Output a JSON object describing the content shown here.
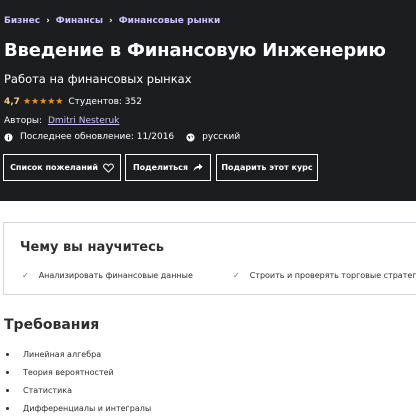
{
  "breadcrumb": [
    {
      "label": "Бизнес"
    },
    {
      "label": "Финансы"
    },
    {
      "label": "Финансовые рынки"
    }
  ],
  "course": {
    "title": "Введение в Финансовую Инженерию",
    "subtitle": "Работа на финансовых рынках",
    "rating": "4,7",
    "rating_stars": 4.5,
    "students": "Студентов: 352",
    "authors_label": "Авторы:",
    "author": "Dmitri Nesteruk",
    "last_updated": "Последнее обновление: 11/2016",
    "language": "русский"
  },
  "buttons": {
    "wishlist": "Список пожеланий",
    "share": "Поделиться",
    "gift": "Подарить этот курс"
  },
  "learn": {
    "title": "Чему вы научитесь",
    "items": [
      "Анализировать финансовые данные",
      "Строить и проверять торговые стратегии"
    ]
  },
  "requirements": {
    "title": "Требования",
    "items": [
      "Линейная алгебра",
      "Теория вероятностей",
      "Статистика",
      "Дифференциалы и интегралы"
    ]
  },
  "colors": {
    "hero_bg": "#1c1d1f",
    "link_purple": "#cec0fc",
    "rating_gold": "#f3ca8c",
    "star_orange": "#e59819",
    "text_dark": "#2d2f31",
    "border": "#d1d7dc"
  },
  "icons": [
    "chevron-right-icon",
    "star-icon",
    "info-icon",
    "globe-icon",
    "heart-icon",
    "share-arrow-icon",
    "check-icon"
  ]
}
